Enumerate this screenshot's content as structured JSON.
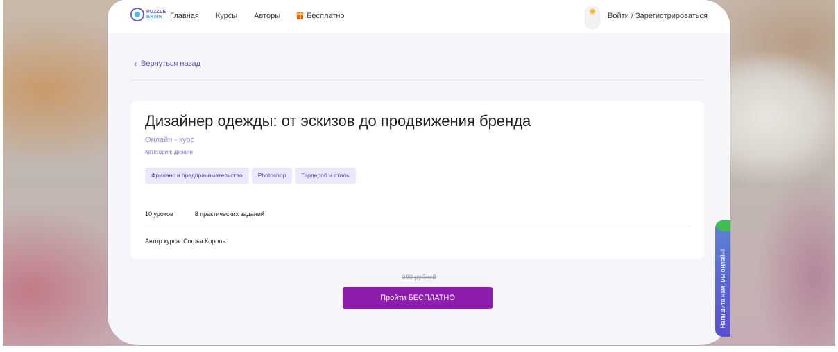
{
  "header": {
    "logo": {
      "line1": "PUZZLE",
      "line2": "BRAIN"
    },
    "nav": [
      {
        "label": "Главная"
      },
      {
        "label": "Курсы"
      },
      {
        "label": "Авторы"
      }
    ],
    "free_label": "Бесплатно",
    "login_label": "Войти / Зарегистрироваться"
  },
  "back_label": "Вернуться назад",
  "course": {
    "title": "Дизайнер одежды: от эскизов до продвижения бренда",
    "type": "Онлайн - курс",
    "category": "Категория: Дизайн",
    "tags": [
      {
        "label": "Фриланс и предпринимательство"
      },
      {
        "label": "Photoshop"
      },
      {
        "label": "Гардероб и стиль"
      }
    ],
    "lessons": "10 уроков",
    "assignments": "8 практических заданий",
    "author": "Автор курса: Софья Король"
  },
  "price": {
    "old": "990 рублей",
    "cta_label": "Пройти БЕСПЛАТНО"
  },
  "chat_widget": {
    "label": "Напишите нам, мы онлайн!"
  },
  "colors": {
    "accent": "#8e1cae",
    "link": "#5b4fc4",
    "tag_bg": "#ebe8fb",
    "chat_bg": "#5a4fd0",
    "online": "#3fbf4f"
  }
}
